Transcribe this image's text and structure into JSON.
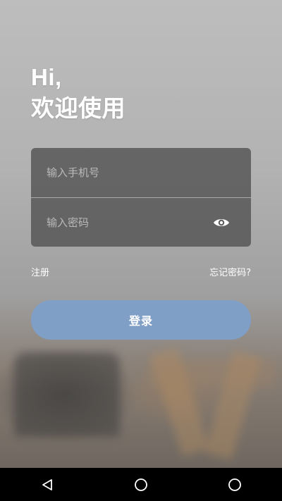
{
  "greeting": {
    "line1": "Hi,",
    "line2": "欢迎使用"
  },
  "form": {
    "phone": {
      "placeholder": "输入手机号",
      "value": ""
    },
    "password": {
      "placeholder": "输入密码",
      "value": "",
      "toggle_icon": "eye-icon"
    }
  },
  "links": {
    "register": "注册",
    "forgot_password": "忘记密码?"
  },
  "login_button": {
    "label": "登录",
    "color": "#7f9fc6"
  },
  "navbar": {
    "back_icon": "back-triangle-icon",
    "home_icon": "home-circle-icon",
    "recent_icon": "recent-circle-icon"
  }
}
